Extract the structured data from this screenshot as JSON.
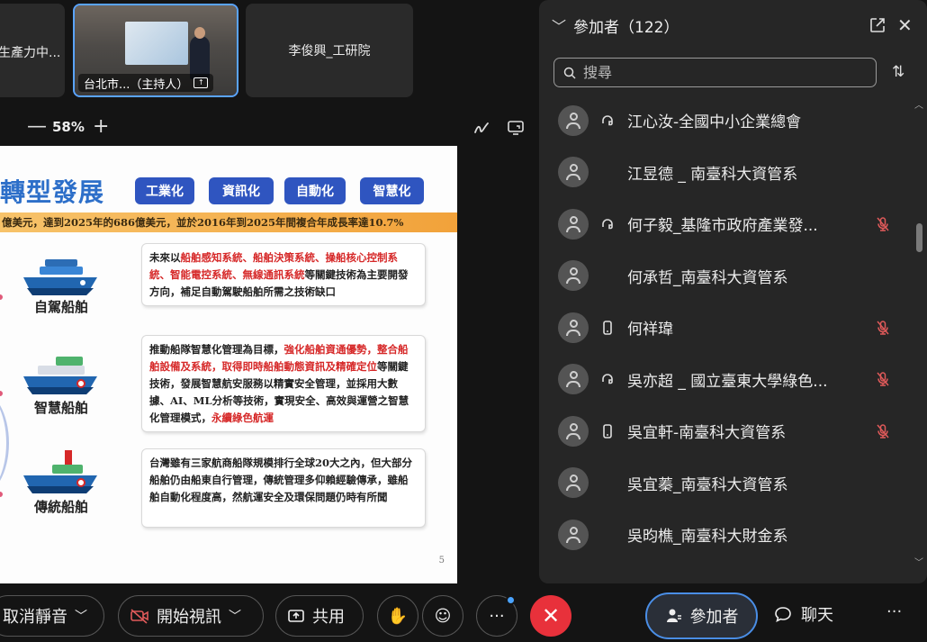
{
  "video_tiles": {
    "left_name": "生產力中...",
    "host_name": "台北市...（主持人）",
    "third_name": "李俊興_工研院"
  },
  "zoom": {
    "minus": "—",
    "level": "58%",
    "plus": "+"
  },
  "slide": {
    "title": "轉型發展",
    "tags": [
      "工業化",
      "資訊化",
      "自動化",
      "智慧化"
    ],
    "banner": "億美元，達到2025年的686億美元，並於2016年到2025年間複合年成長率達10.7%",
    "ships": [
      {
        "label": "自駕船舶"
      },
      {
        "label": "智慧船舶"
      },
      {
        "label": "傳統船舶"
      }
    ],
    "desc1": {
      "a": "未來以",
      "b": "船舶感知系統、船舶決策系統、操船核心控制系統、智能電控系統、無線通訊系統",
      "c": "等關鍵技術為主要開發方向，補足自動駕駛船舶所需之技術缺口"
    },
    "desc2": {
      "a": "推動船隊智慧化管理為目標，",
      "b": "強化船舶資通優勢，整合船舶設備及系統，取得即時船舶動態資訊及精確定位",
      "c": "等關鍵技術，發展智慧航安服務以精實安全管理，並採用大數據、AI、ML分析等技術，實現安全、高效與運營之智慧化管理模式，",
      "d": "永續綠色航運"
    },
    "desc3": "台灣雖有三家航商船隊規模排行全球20大之內，但大部分船舶仍由船東自行管理，傳統管理多仰賴經驗傳承，雖船舶自動化程度高，然航運安全及環保問題仍時有所聞",
    "page_number": "5"
  },
  "panel": {
    "title": "參加者（122）",
    "search_placeholder": "搜尋",
    "participants": [
      {
        "name": "江心汝-全國中小企業總會",
        "device": "phone",
        "muted": false
      },
      {
        "name": "江昱德 _ 南臺科大資管系",
        "device": "none",
        "muted": false
      },
      {
        "name": "何子毅_基隆市政府產業發...",
        "device": "phone",
        "muted": true
      },
      {
        "name": "何承哲_南臺科大資管系",
        "device": "none",
        "muted": false
      },
      {
        "name": "何祥瑋",
        "device": "mobile",
        "muted": true
      },
      {
        "name": "吳亦超 _ 國立臺東大學綠色...",
        "device": "phone",
        "muted": true
      },
      {
        "name": "吳宜軒-南臺科大資管系",
        "device": "mobile",
        "muted": true
      },
      {
        "name": "吳宜蓁_南臺科大資管系",
        "device": "none",
        "muted": false
      },
      {
        "name": "吳昀樵_南臺科大財金系",
        "device": "none",
        "muted": false
      }
    ]
  },
  "toolbar": {
    "unmute": "取消靜音",
    "start_video": "開始視訊",
    "share": "共用",
    "more": "···",
    "participants": "參加者",
    "chat": "聊天",
    "more_right": "···"
  },
  "colors": {
    "accent": "#4a8ee6",
    "leave": "#e8313b",
    "muted_red": "#e05a5a",
    "slide_title": "#2d6fc9",
    "tag_blue": "#2f55c0"
  }
}
